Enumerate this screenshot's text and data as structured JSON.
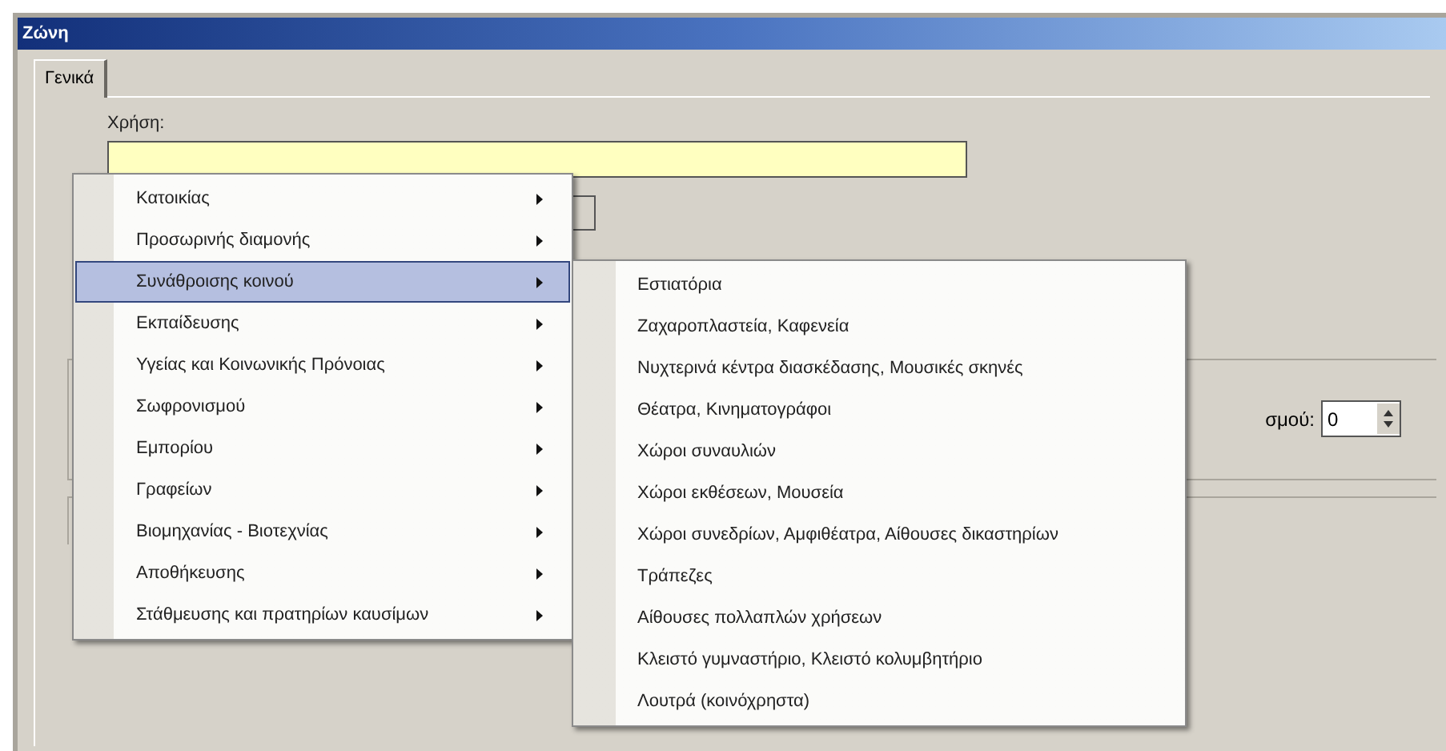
{
  "window": {
    "title": "Ζώνη"
  },
  "tabs": [
    {
      "label": "Γενικά",
      "selected": true
    }
  ],
  "usage": {
    "label": "Χρήση:"
  },
  "spin": {
    "label": "σμού:",
    "value": "0"
  },
  "menu": {
    "items": [
      {
        "label": "Κατοικίας",
        "has_submenu": true,
        "selected": false
      },
      {
        "label": "Προσωρινής διαμονής",
        "has_submenu": true,
        "selected": false
      },
      {
        "label": "Συνάθροισης κοινού",
        "has_submenu": true,
        "selected": true
      },
      {
        "label": "Εκπαίδευσης",
        "has_submenu": true,
        "selected": false
      },
      {
        "label": "Υγείας και Κοινωνικής Πρόνοιας",
        "has_submenu": true,
        "selected": false
      },
      {
        "label": "Σωφρονισμού",
        "has_submenu": true,
        "selected": false
      },
      {
        "label": "Εμπορίου",
        "has_submenu": true,
        "selected": false
      },
      {
        "label": "Γραφείων",
        "has_submenu": true,
        "selected": false
      },
      {
        "label": "Βιομηχανίας - Βιοτεχνίας",
        "has_submenu": true,
        "selected": false
      },
      {
        "label": "Αποθήκευσης",
        "has_submenu": true,
        "selected": false
      },
      {
        "label": "Στάθμευσης και πρατηρίων καυσίμων",
        "has_submenu": true,
        "selected": false
      }
    ]
  },
  "submenu": {
    "items": [
      {
        "label": "Εστιατόρια"
      },
      {
        "label": "Ζαχαροπλαστεία, Καφενεία"
      },
      {
        "label": "Νυχτερινά κέντρα διασκέδασης, Μουσικές σκηνές"
      },
      {
        "label": "Θέατρα, Κινηματογράφοι"
      },
      {
        "label": "Χώροι συναυλιών"
      },
      {
        "label": "Χώροι εκθέσεων, Μουσεία"
      },
      {
        "label": "Χώροι συνεδρίων, Αμφιθέατρα, Αίθουσες δικαστηρίων"
      },
      {
        "label": "Τράπεζες"
      },
      {
        "label": "Αίθουσες πολλαπλών χρήσεων"
      },
      {
        "label": "Κλειστό γυμναστήριο, Κλειστό κολυμβητήριο"
      },
      {
        "label": "Λουτρά (κοινόχρηστα)"
      }
    ]
  }
}
